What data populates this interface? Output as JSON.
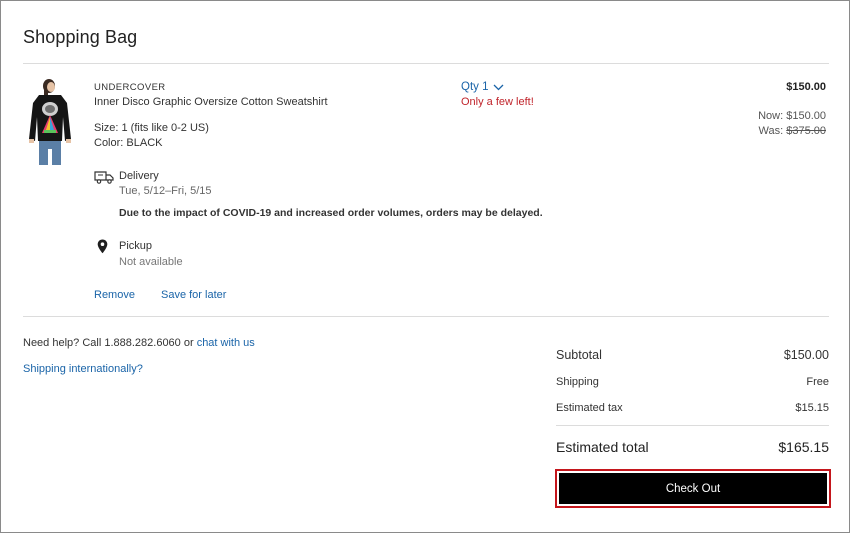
{
  "page": {
    "title": "Shopping Bag"
  },
  "item": {
    "brand": "UNDERCOVER",
    "name": "Inner Disco Graphic Oversize Cotton Sweatshirt",
    "size": "Size: 1 (fits like 0-2 US)",
    "color": "Color: BLACK",
    "qty_label": "Qty 1",
    "stock_message": "Only a few left!",
    "price": "$150.00",
    "now_label": "Now: ",
    "now_price": "$150.00",
    "was_label": "Was: ",
    "was_price": "$375.00",
    "delivery": {
      "label": "Delivery",
      "date": "Tue, 5/12–Fri, 5/15",
      "notice": "Due to the impact of COVID-19 and increased order volumes, orders may be delayed."
    },
    "pickup": {
      "label": "Pickup",
      "status": "Not available"
    },
    "actions": {
      "remove": "Remove",
      "save_for_later": "Save for later"
    }
  },
  "help": {
    "text": "Need help? Call 1.888.282.6060 or ",
    "chat_link": "chat with us",
    "shipping_intl": "Shipping internationally?"
  },
  "summary": {
    "subtotal_label": "Subtotal",
    "subtotal_value": "$150.00",
    "shipping_label": "Shipping",
    "shipping_value": "Free",
    "tax_label": "Estimated tax",
    "tax_value": "$15.15",
    "total_label": "Estimated total",
    "total_value": "$165.15",
    "checkout_label": "Check Out"
  },
  "icons": {
    "delivery": "truck-icon",
    "pickup": "location-pin-icon",
    "qty": "chevron-down-icon"
  },
  "colors": {
    "link": "#1a64a8",
    "alert": "#c0242b",
    "checkout_bg": "#000000",
    "checkout_focus": "#c4161c"
  }
}
